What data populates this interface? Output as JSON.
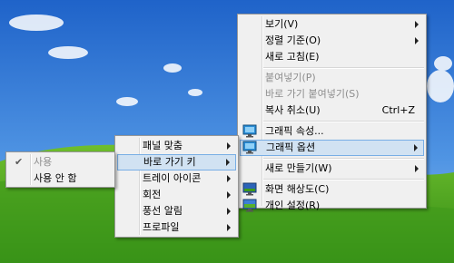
{
  "desktop": {
    "sky_color": "#2f79d8",
    "grass_color": "#4ea81f"
  },
  "menu_main": {
    "items": [
      {
        "label": "보기(V)",
        "submenu": true
      },
      {
        "label": "정렬 기준(O)",
        "submenu": true
      },
      {
        "label": "새로 고침(E)"
      },
      {
        "label": "붙여넣기(P)",
        "disabled": true
      },
      {
        "label": "바로 가기 붙여넣기(S)",
        "disabled": true
      },
      {
        "label": "복사 취소(U)",
        "shortcut": "Ctrl+Z"
      },
      {
        "label": "그래픽 속성...",
        "icon": "graphics-properties-icon"
      },
      {
        "label": "그래픽 옵션",
        "icon": "graphics-options-icon",
        "submenu": true,
        "highlighted": true
      },
      {
        "label": "새로 만들기(W)",
        "submenu": true
      },
      {
        "label": "화면 해상도(C)",
        "icon": "screen-resolution-icon"
      },
      {
        "label": "개인 설정(R)",
        "icon": "personalize-icon"
      }
    ]
  },
  "menu_graphics_options": {
    "items": [
      {
        "label": "패널 맞춤",
        "submenu": true
      },
      {
        "label": "바로 가기 키",
        "submenu": true,
        "highlighted": true
      },
      {
        "label": "트레이 아이콘",
        "submenu": true
      },
      {
        "label": "회전",
        "submenu": true
      },
      {
        "label": "풍선 알림",
        "submenu": true
      },
      {
        "label": "프로파일",
        "submenu": true
      }
    ]
  },
  "menu_hotkeys": {
    "items": [
      {
        "label": "사용",
        "disabled": true,
        "checked": true,
        "check_glyph": "✔"
      },
      {
        "label": "사용 안 함"
      }
    ]
  }
}
